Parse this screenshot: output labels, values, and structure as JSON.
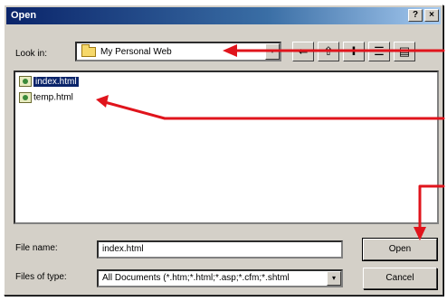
{
  "window": {
    "title": "Open",
    "help_glyph": "?",
    "close_glyph": "×"
  },
  "look_in": {
    "label": "Look in:",
    "value": "My Personal Web",
    "arrow_glyph": "▾"
  },
  "toolbar": [
    {
      "name": "back-icon",
      "glyph": "⇐"
    },
    {
      "name": "up-folder-icon",
      "glyph": "⇧"
    },
    {
      "name": "new-folder-icon",
      "glyph": "✚"
    },
    {
      "name": "list-view-icon",
      "glyph": "☰"
    },
    {
      "name": "details-view-icon",
      "glyph": "▤"
    }
  ],
  "files": [
    {
      "name": "index.html",
      "selected": true
    },
    {
      "name": "temp.html",
      "selected": false
    }
  ],
  "file_name": {
    "label": "File name:",
    "value": "index.html"
  },
  "file_type": {
    "label": "Files of type:",
    "value": "All Documents (*.htm;*.html;*.asp;*.cfm;*.shtml",
    "arrow_glyph": "▾"
  },
  "buttons": {
    "open": "Open",
    "cancel": "Cancel"
  },
  "colors": {
    "annotation_arrow": "#e0141c",
    "selection": "#0a246a",
    "title_bar": "#0a246a"
  }
}
